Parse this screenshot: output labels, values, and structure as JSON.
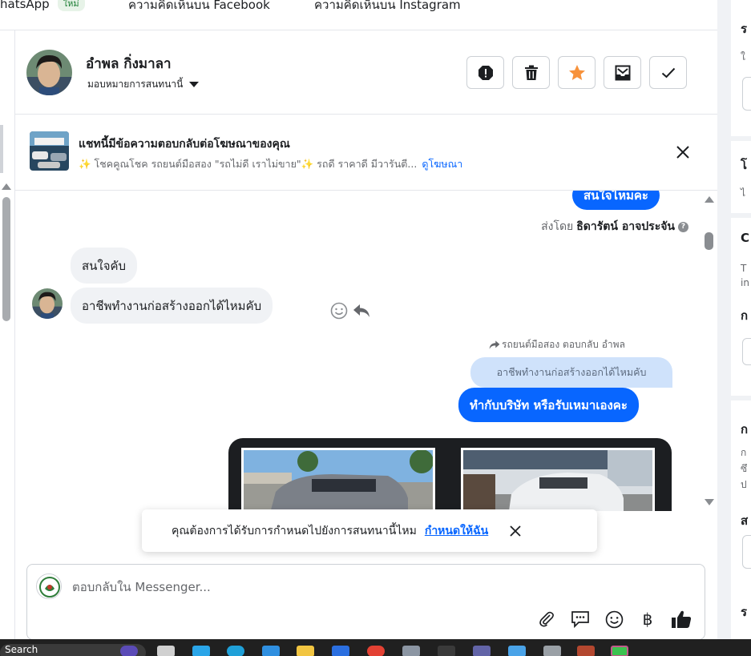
{
  "tabs": [
    {
      "label": "hatsApp",
      "badge": "ใหม่"
    },
    {
      "label": "ความคิดเห็นบน Facebook"
    },
    {
      "label": "ความคิดเห็นบน Instagram"
    }
  ],
  "header": {
    "contact_name": "อำพล กิ่งมาลา",
    "assign_label": "มอบหมายการสนทนานี้",
    "actions": [
      {
        "name": "spam-button",
        "icon": "alert-octagon-icon"
      },
      {
        "name": "delete-button",
        "icon": "trash-icon"
      },
      {
        "name": "star-button",
        "icon": "star-icon"
      },
      {
        "name": "move-to-inbox-button",
        "icon": "inbox-icon"
      },
      {
        "name": "mark-done-button",
        "icon": "check-icon"
      }
    ]
  },
  "ad_banner": {
    "title": "แชทนี้มีข้อความตอบกลับต่อโฆษณาของคุณ",
    "description": "✨ โชคคูณโชค รถยนต์มือสอง \"รถไม่ดี เราไม่ขาย\"✨ รถดี ราคาดี มีวารันตี...",
    "link": "ดูโฆษณา"
  },
  "messages": {
    "top_outgoing_partial": "สนใจไหมคะ",
    "sent_by_prefix": "ส่งโดย",
    "sent_by_name": "ธิดารัตน์ อาจประจัน",
    "incoming": [
      "สนใจคับ",
      "อาชีพทำงานก่อสร้างออกได้ไหมคับ"
    ],
    "reply_label": "รถยนต์มือสอง ตอบกลับ อำพล",
    "quoted_text": "อาชีพทำงานก่อสร้างออกได้ไหมคับ",
    "outgoing_reply": "ทำกับบริษัท หรือรับเหมาเองคะ"
  },
  "toast": {
    "text": "คุณต้องการได้รับการกำหนดไปยังการสนทนานี้ไหม",
    "link": "กำหนดให้ฉัน"
  },
  "composer": {
    "placeholder": "ตอบกลับใน Messenger...",
    "tools": [
      "attach-icon",
      "saved-replies-icon",
      "emoji-icon",
      "baht-icon",
      "thumbs-up-icon"
    ],
    "baht_symbol": "฿"
  },
  "taskbar": {
    "search_label": "Search"
  },
  "colors": {
    "accent": "#0866ff",
    "star": "#f7923b",
    "bubble_in": "#f0f2f5",
    "quoted": "#cfe2fb"
  }
}
